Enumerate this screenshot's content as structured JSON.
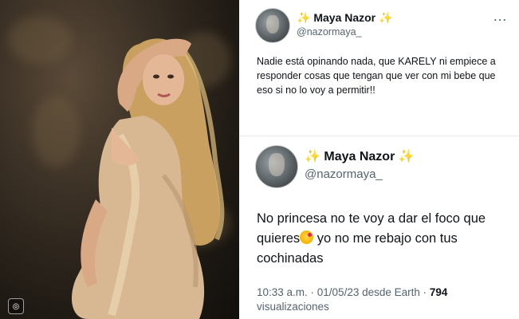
{
  "photo": {
    "icon": "instagram-icon"
  },
  "tweet1": {
    "name": "Maya Nazor",
    "sparkle": "✨",
    "handle": "@nazormaya_",
    "more": "…",
    "text": "Nadie está opinando nada, que KARELY ni empiece a responder cosas que tengan que ver con mi bebe que eso si no lo voy a permitir!!"
  },
  "tweet2": {
    "name": "Maya Nazor",
    "sparkle": "✨",
    "handle": "@nazormaya_",
    "text_part1": "No princesa no te voy a dar el foco que quieres",
    "text_part2": " yo no me rebajo con tus cochinadas",
    "emoji": "face-blowing-kiss-emoji",
    "meta_prefix": "10:33 a.m. · 01/05/23 desde Earth · ",
    "views_count": "794",
    "views_label": "visualizaciones"
  },
  "colors": {
    "text": "#0f1419",
    "secondary": "#536471",
    "sparkle": "#e8b423"
  }
}
